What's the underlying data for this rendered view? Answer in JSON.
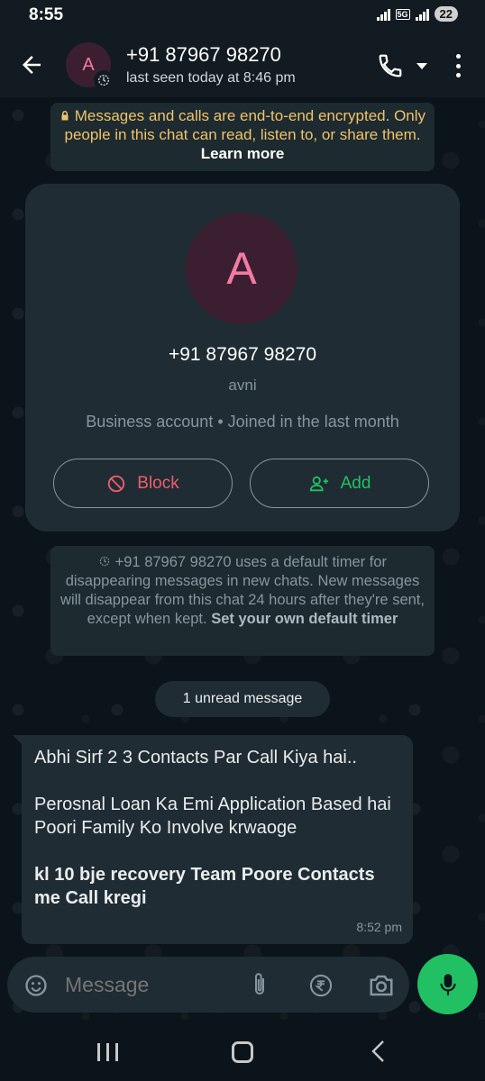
{
  "status_bar": {
    "time": "8:55",
    "network": "5G",
    "battery": "22"
  },
  "header": {
    "avatar_letter": "A",
    "contact_name": "+91 87967 98270",
    "last_seen": "last seen today at 8:46 pm"
  },
  "encryption_notice": {
    "text": "Messages and calls are end-to-end encrypted. Only people in this chat can read, listen to, or share them.",
    "link": "Learn more"
  },
  "profile_card": {
    "avatar_letter": "A",
    "phone": "+91 87967 98270",
    "username": "avni",
    "info": "Business account • Joined in the last month",
    "block_label": "Block",
    "add_label": "Add"
  },
  "disappearing_notice": {
    "text": "+91 87967 98270 uses a default timer for disappearing messages in new chats. New messages will disappear from this chat 24 hours after they're sent, except when kept.",
    "link": "Set your own default timer"
  },
  "unread_label": "1 unread message",
  "message": {
    "line1": "Abhi Sirf 2 3 Contacts Par Call Kiya hai..",
    "line2": "Perosnal Loan Ka Emi Application Based hai",
    "line3": "Poori Family Ko Involve krwaoge",
    "line4": "kl 10 bje recovery Team Poore Contacts me Call kregi",
    "time": "8:52 pm"
  },
  "composer": {
    "placeholder": "Message"
  },
  "colors": {
    "background": "#0b141a",
    "accent_green": "#21c063",
    "block_red": "#f15c6d",
    "notice_yellow": "#f0c36a"
  },
  "icons": [
    "back-arrow-icon",
    "timer-icon",
    "phone-icon",
    "more-vert-icon",
    "lock-icon",
    "block-icon",
    "add-person-icon",
    "emoji-icon",
    "attach-icon",
    "rupee-icon",
    "camera-icon",
    "mic-icon"
  ]
}
